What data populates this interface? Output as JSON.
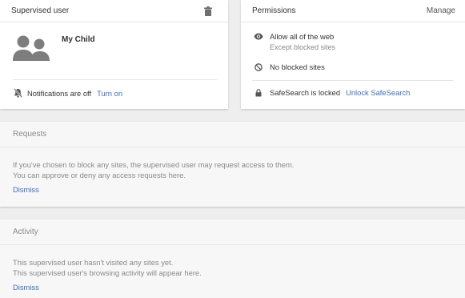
{
  "supervised": {
    "header_title": "Supervised user",
    "delete_icon": "trash-icon",
    "avatar_icon": "people-icon",
    "user_name": "My Child",
    "notifications_text": "Notifications are off",
    "notifications_icon": "bell-off-icon",
    "turn_on_label": "Turn on"
  },
  "permissions": {
    "header_title": "Permissions",
    "manage_label": "Manage",
    "allow_title": "Allow all of the web",
    "allow_subtitle": "Except blocked sites",
    "allow_icon": "eye-icon",
    "blocked_text": "No blocked sites",
    "blocked_icon": "block-icon",
    "safesearch_text": "SafeSearch is locked",
    "safesearch_icon": "lock-icon",
    "unlock_label": "Unlock SafeSearch"
  },
  "requests": {
    "header_title": "Requests",
    "line1": "If you've chosen to block any sites, the supervised user may request access to them.",
    "line2": "You can approve or deny any access requests here.",
    "dismiss_label": "Dismiss"
  },
  "activity": {
    "header_title": "Activity",
    "line1": "This supervised user hasn't visited any sites yet.",
    "line2": "This supervised user's browsing activity will appear here.",
    "dismiss_label": "Dismiss"
  },
  "colors": {
    "accent_link": "#3b6fc4",
    "background": "#eeeeee",
    "muted_text": "#8a8a8a"
  }
}
